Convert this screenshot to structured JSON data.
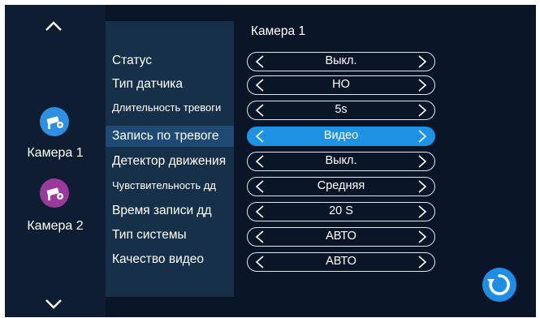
{
  "sidebar": {
    "cameras": [
      {
        "label": "Камера 1",
        "icon": "camera-settings-icon",
        "color": "#2f8fe0"
      },
      {
        "label": "Камера 2",
        "icon": "camera-settings-icon",
        "color": "#9a3a9c"
      }
    ],
    "up_icon": "chevron-up-icon",
    "down_icon": "chevron-down-icon"
  },
  "title": "Камера 1",
  "settings": [
    {
      "label": "Статус",
      "value": "Выкл."
    },
    {
      "label": "Тип датчика",
      "value": "НО"
    },
    {
      "label": "Длительность тревоги",
      "value": "5s"
    },
    {
      "label": "Запись по тревоге",
      "value": "Видео"
    },
    {
      "label": "Детектор движения",
      "value": "Выкл."
    },
    {
      "label": "Чувствительность дд",
      "value": "Средняя"
    },
    {
      "label": "Время записи дд",
      "value": "20 S"
    },
    {
      "label": "Тип системы",
      "value": "АВТО"
    },
    {
      "label": "Качество видео",
      "value": "АВТО"
    }
  ],
  "highlighted_row": "Запись по тревоге",
  "refresh_icon": "refresh-icon",
  "colors": {
    "accent": "#1e93e6",
    "panel": "#16304a",
    "background": "#0a1628"
  }
}
